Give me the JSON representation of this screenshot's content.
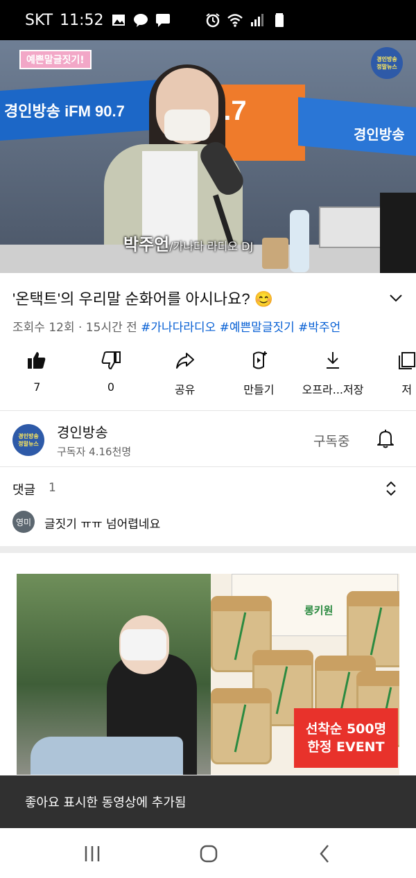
{
  "status_bar": {
    "carrier": "SKT",
    "time": "11:52",
    "left_icons": [
      "gallery-icon",
      "kakaotalk-icon",
      "message-icon"
    ],
    "right_icons": [
      "alarm-icon",
      "wifi-icon",
      "signal-icon",
      "battery-icon"
    ]
  },
  "video": {
    "overlay_tag": "예쁜말글짓기!",
    "channel_badge": [
      "경인방송",
      "정말뉴스"
    ],
    "banner_left": "경인방송 iFM 90.7",
    "banner_mid": "0.7",
    "banner_right": "경인방송",
    "caption_name": "박주언",
    "caption_role": "/가나다 라디오 DJ"
  },
  "title": "'온택트'의 우리말 순화어를 아시나요? 😊",
  "meta": {
    "views": "조회수 12회 · 15시간 전",
    "tags": "#가나다라디오 #예쁜말글짓기 #박주언"
  },
  "actions": [
    {
      "icon": "thumbs-up-icon",
      "label": "7"
    },
    {
      "icon": "thumbs-down-icon",
      "label": "0"
    },
    {
      "icon": "share-icon",
      "label": "공유"
    },
    {
      "icon": "create-icon",
      "label": "만들기"
    },
    {
      "icon": "download-icon",
      "label": "오프라...저장"
    },
    {
      "icon": "save-icon",
      "label": "저"
    }
  ],
  "channel": {
    "name": "경인방송",
    "subscribers": "구독자 4.16천명",
    "subscribe_state": "구독중",
    "avatar_text": [
      "경인방송",
      "정말뉴스"
    ]
  },
  "comments": {
    "label": "댓글",
    "count": "1",
    "top_comment": {
      "avatar": "영미",
      "text": "글짓기 ㅠㅠ 넘어렵네요"
    }
  },
  "ad": {
    "event_line1": "선착순 500명",
    "event_line2": "한정 EVENT",
    "product_label": "롱키원"
  },
  "toast": "좋아요 표시한 동영상에 추가됨",
  "nav": [
    "recent-apps-icon",
    "home-icon",
    "back-icon"
  ]
}
